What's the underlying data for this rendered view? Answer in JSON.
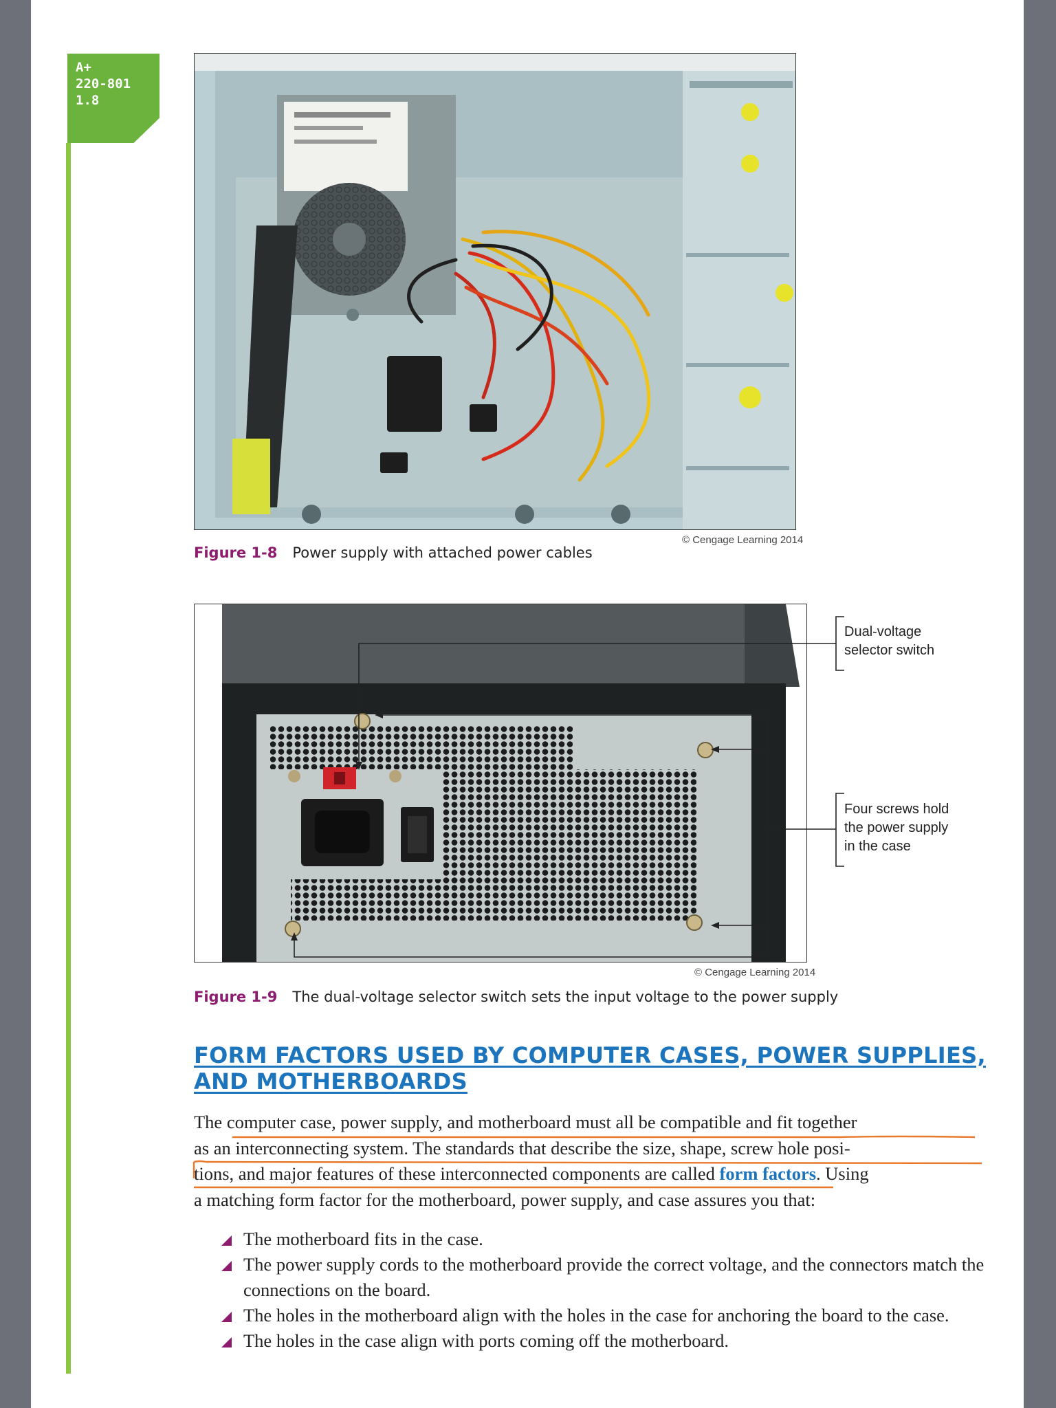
{
  "objective_tab": {
    "line1": "A+",
    "line2": "220-801",
    "line3": "1.8"
  },
  "figure_1_8": {
    "credit": "© Cengage Learning 2014",
    "number": "Figure 1-8",
    "caption": "Power supply with attached power cables"
  },
  "figure_1_9": {
    "credit": "© Cengage Learning 2014",
    "number": "Figure 1-9",
    "caption": "The dual-voltage selector switch sets the input voltage to the power supply",
    "callout_switch_line1": "Dual-voltage",
    "callout_switch_line2": "selector switch",
    "callout_screws_line1": "Four screws hold",
    "callout_screws_line2": "the power supply",
    "callout_screws_line3": "in the case"
  },
  "section": {
    "heading_line1": "FORM FACTORS USED BY COMPUTER CASES, POWER SUPPLIES,",
    "heading_line2": "AND MOTHERBOARDS",
    "para_line1": "The computer case, power supply, and motherboard must all be compatible and fit together",
    "para_line2": "as an interconnecting system. The standards that describe the size, shape, screw hole posi-",
    "para_line3_a": "tions, and major features of these interconnected components are called ",
    "para_line3_term": "form factors",
    "para_line3_b": ". Using",
    "para_line4": "a matching form factor for the motherboard, power supply, and case assures you that:",
    "bullets": [
      "The motherboard fits in the case.",
      "The power supply cords to the motherboard provide the correct voltage, and the connectors match the connections on the board.",
      "The holes in the motherboard align with the holes in the case for anchoring the board to the case.",
      "The holes in the case align with ports coming off the motherboard."
    ]
  },
  "colors": {
    "green_tab": "#6cb33e",
    "green_rule": "#8dc63f",
    "figure_label": "#8d1b6e",
    "heading_blue": "#1c75bc",
    "margin_gray": "#6e7079",
    "annotation_underline": "#e8782a"
  }
}
